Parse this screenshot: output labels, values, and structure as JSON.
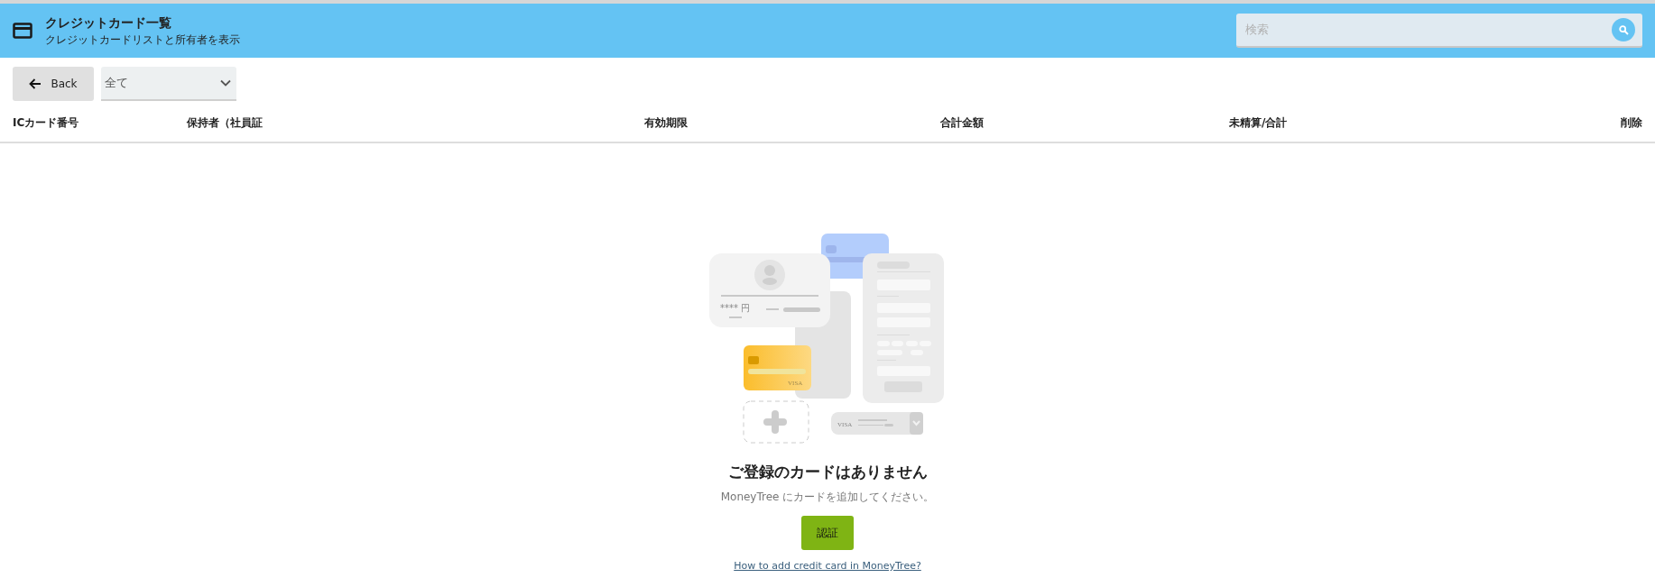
{
  "header": {
    "title": "クレジットカード一覧",
    "subtitle": "クレジットカードリストと所有者を表示",
    "search": {
      "placeholder": "検索"
    }
  },
  "toolbar": {
    "back_button": "Back",
    "filter": {
      "value": "全て"
    }
  },
  "table": {
    "columns": [
      "ICカード番号",
      "保持者（社員証",
      "有効期限",
      "合計金額",
      "未精算/合計",
      "削除"
    ]
  },
  "empty_state": {
    "illustration": {
      "amount_text": "**** 円",
      "card_brand": "VISA",
      "dropdown_brand": "VISA"
    },
    "title": "ご登録のカードはありません",
    "message": "MoneyTree にカードを追加してください。",
    "button": "認証",
    "link": "How to add credit card in MoneyTree?"
  }
}
